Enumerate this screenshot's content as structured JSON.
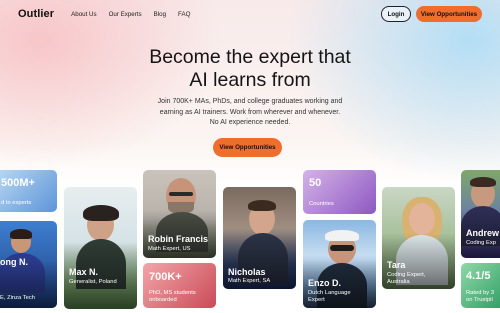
{
  "nav": {
    "logo": "Outlier",
    "links": [
      "About Us",
      "Our Experts",
      "Blog",
      "FAQ"
    ],
    "login": "Login",
    "cta": "View Opportunities"
  },
  "hero": {
    "title_line1": "Become the expert that",
    "title_line2": "AI learns from",
    "sub_line1": "Join 700K+ MAs, PhDs, and college graduates working and",
    "sub_line2": "earning as AI trainers. Work from wherever and whenever.",
    "sub_line3": "No AI experience needed.",
    "cta": "View Opportunities"
  },
  "cards": {
    "stat_500m": {
      "value": "500M+",
      "label": "d to experts"
    },
    "person_zinza": {
      "name": "ong N.",
      "role": "E, Zinza Tech"
    },
    "max": {
      "name": "Max N.",
      "role": "Generalist, Poland"
    },
    "robin": {
      "name": "Robin Francis",
      "role": "Math Expert, US"
    },
    "stat_700k": {
      "value": "700K+",
      "label1": "PhD, MS students",
      "label2": "onboarded"
    },
    "nicholas": {
      "name": "Nicholas",
      "role": "Math Expert, SA"
    },
    "stat_50": {
      "value": "50",
      "label": "Countries"
    },
    "enzo": {
      "name": "Enzo D.",
      "role1": "Dutch Language",
      "role2": "Expert"
    },
    "tara": {
      "name": "Tara",
      "role1": "Coding Expert,",
      "role2": "Australia"
    },
    "andrew": {
      "name": "Andrew",
      "role": "Coding Exp"
    },
    "stat_rating": {
      "value": "4.1/5",
      "label1": "Rated by 3",
      "label2": "on Trustpil"
    }
  }
}
